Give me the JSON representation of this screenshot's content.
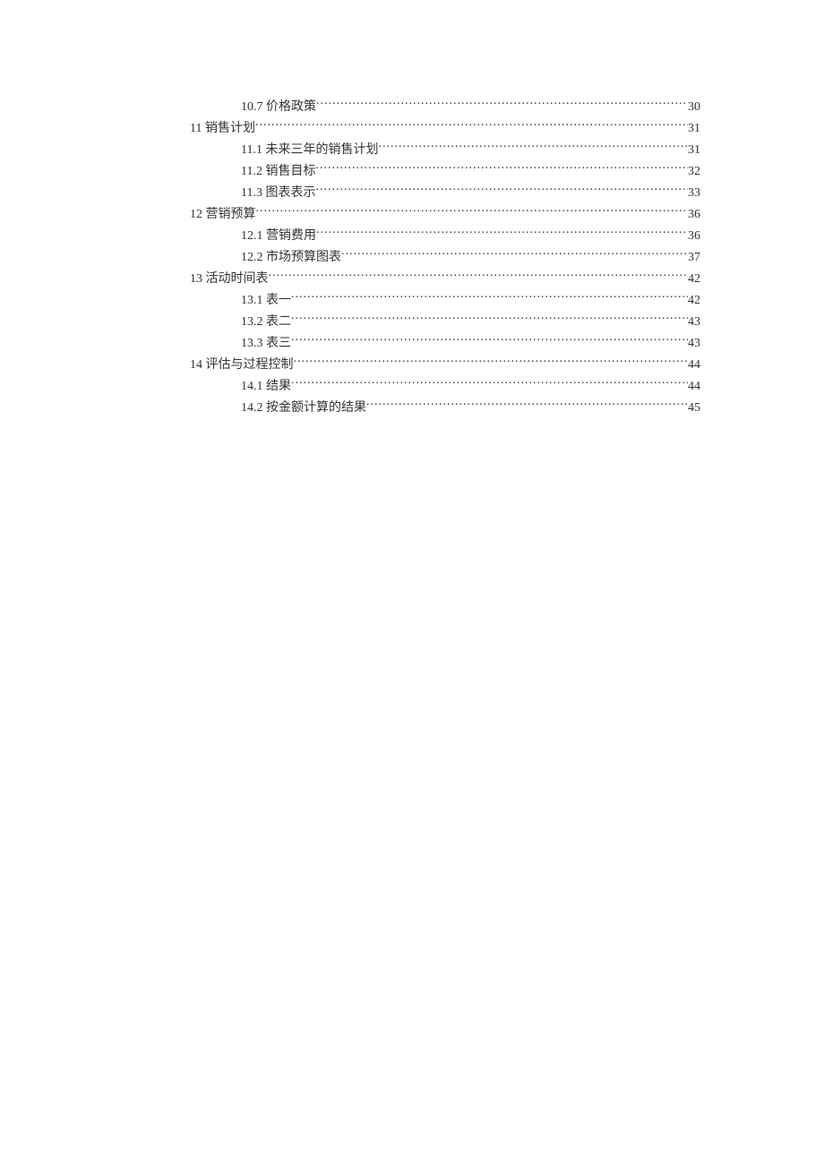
{
  "toc": [
    {
      "level": 2,
      "label": "10.7  价格政策",
      "page": "30"
    },
    {
      "level": 1,
      "label": "11  销售计划",
      "page": "31"
    },
    {
      "level": 2,
      "label": "11.1  未来三年的销售计划",
      "page": "31"
    },
    {
      "level": 2,
      "label": "11.2  销售目标",
      "page": "32"
    },
    {
      "level": 2,
      "label": "11.3  图表表示",
      "page": "33"
    },
    {
      "level": 1,
      "label": "12  营销预算",
      "page": "36"
    },
    {
      "level": 2,
      "label": "12.1  营销费用",
      "page": "36"
    },
    {
      "level": 2,
      "label": "12.2  市场预算图表",
      "page": "37"
    },
    {
      "level": 1,
      "label": "13  活动时间表",
      "page": "42"
    },
    {
      "level": 2,
      "label": "13.1  表一",
      "page": "42"
    },
    {
      "level": 2,
      "label": "13.2  表二",
      "page": "43"
    },
    {
      "level": 2,
      "label": "13.3  表三",
      "page": "43"
    },
    {
      "level": 1,
      "label": "14  评估与过程控制",
      "page": "44"
    },
    {
      "level": 2,
      "label": "14.1  结果",
      "page": "44"
    },
    {
      "level": 2,
      "label": "14.2  按金额计算的结果",
      "page": "45"
    }
  ]
}
